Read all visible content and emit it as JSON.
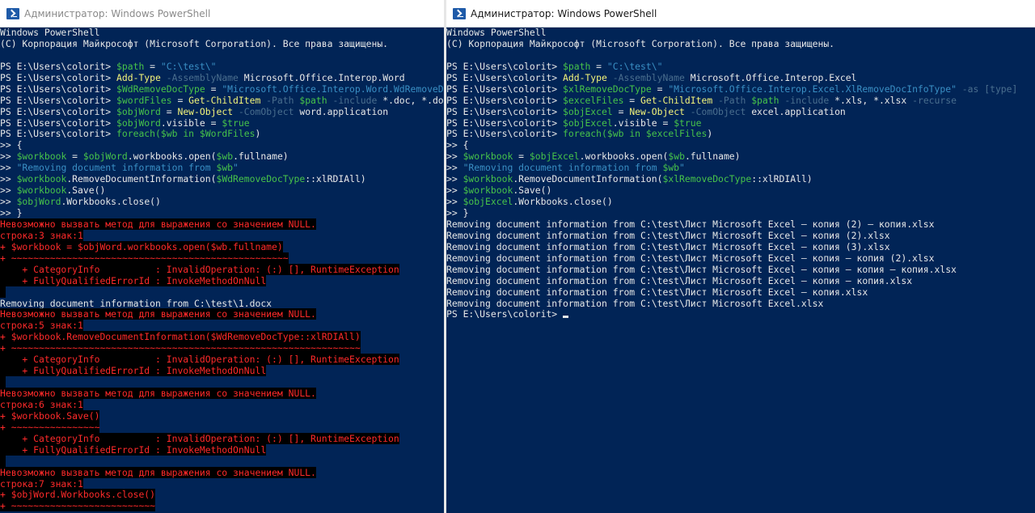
{
  "left": {
    "title": "Администратор: Windows PowerShell",
    "lines": [
      {
        "cls": "w",
        "segs": [
          {
            "t": "Windows PowerShell",
            "c": "w"
          }
        ]
      },
      {
        "cls": "w",
        "segs": [
          {
            "t": "(С) Корпорация Майкрософт (Microsoft Corporation). Все права защищены.",
            "c": "w"
          }
        ]
      },
      {
        "cls": "w",
        "segs": []
      },
      {
        "cls": "w",
        "segs": [
          {
            "t": "PS E:\\Users\\colorit> ",
            "c": "w"
          },
          {
            "t": "$path",
            "c": "g"
          },
          {
            "t": " = ",
            "c": "w"
          },
          {
            "t": "\"C:\\test\\\"",
            "c": "cy"
          }
        ]
      },
      {
        "cls": "w",
        "segs": [
          {
            "t": "PS E:\\Users\\colorit> ",
            "c": "w"
          },
          {
            "t": "Add-Type",
            "c": "y"
          },
          {
            "t": " -AssemblyName",
            "c": "gy"
          },
          {
            "t": " Microsoft.Office.Interop.Word",
            "c": "w"
          }
        ]
      },
      {
        "cls": "w",
        "segs": [
          {
            "t": "PS E:\\Users\\colorit> ",
            "c": "w"
          },
          {
            "t": "$WdRemoveDocType",
            "c": "g"
          },
          {
            "t": " = ",
            "c": "w"
          },
          {
            "t": "\"Microsoft.Office.Interop.Word.WdRemoveD",
            "c": "cy"
          }
        ]
      },
      {
        "cls": "w",
        "segs": [
          {
            "t": "PS E:\\Users\\colorit> ",
            "c": "w"
          },
          {
            "t": "$wordFiles",
            "c": "g"
          },
          {
            "t": " = ",
            "c": "w"
          },
          {
            "t": "Get-ChildItem",
            "c": "y"
          },
          {
            "t": " -Path ",
            "c": "gy"
          },
          {
            "t": "$path",
            "c": "g"
          },
          {
            "t": " -include",
            "c": "gy"
          },
          {
            "t": " *.doc, *.do",
            "c": "w"
          }
        ]
      },
      {
        "cls": "w",
        "segs": [
          {
            "t": "PS E:\\Users\\colorit> ",
            "c": "w"
          },
          {
            "t": "$objWord",
            "c": "g"
          },
          {
            "t": " = ",
            "c": "w"
          },
          {
            "t": "New-Object",
            "c": "y"
          },
          {
            "t": " -ComObject",
            "c": "gy"
          },
          {
            "t": " word.application",
            "c": "w"
          }
        ]
      },
      {
        "cls": "w",
        "segs": [
          {
            "t": "PS E:\\Users\\colorit> ",
            "c": "w"
          },
          {
            "t": "$objWord",
            "c": "g"
          },
          {
            "t": ".visible = ",
            "c": "w"
          },
          {
            "t": "$true",
            "c": "g"
          }
        ]
      },
      {
        "cls": "w",
        "segs": [
          {
            "t": "PS E:\\Users\\colorit> ",
            "c": "w"
          },
          {
            "t": "foreach(",
            "c": "g"
          },
          {
            "t": "$wb in $WordFiles",
            "c": "g"
          },
          {
            "t": ")",
            "c": "w"
          }
        ]
      },
      {
        "cls": "w",
        "segs": [
          {
            "t": ">> {",
            "c": "w"
          }
        ]
      },
      {
        "cls": "w",
        "segs": [
          {
            "t": ">> ",
            "c": "w"
          },
          {
            "t": "$workbook",
            "c": "g"
          },
          {
            "t": " = ",
            "c": "w"
          },
          {
            "t": "$objWord",
            "c": "g"
          },
          {
            "t": ".workbooks.open(",
            "c": "w"
          },
          {
            "t": "$wb",
            "c": "g"
          },
          {
            "t": ".fullname)",
            "c": "w"
          }
        ]
      },
      {
        "cls": "w",
        "segs": [
          {
            "t": ">> ",
            "c": "w"
          },
          {
            "t": "\"Removing document information from ",
            "c": "cy"
          },
          {
            "t": "$wb",
            "c": "g"
          },
          {
            "t": "\"",
            "c": "cy"
          }
        ]
      },
      {
        "cls": "w",
        "segs": [
          {
            "t": ">> ",
            "c": "w"
          },
          {
            "t": "$workbook",
            "c": "g"
          },
          {
            "t": ".RemoveDocumentInformation(",
            "c": "w"
          },
          {
            "t": "$WdRemoveDocType",
            "c": "g"
          },
          {
            "t": "::xlRDIAll)",
            "c": "w"
          }
        ]
      },
      {
        "cls": "w",
        "segs": [
          {
            "t": ">> ",
            "c": "w"
          },
          {
            "t": "$workbook",
            "c": "g"
          },
          {
            "t": ".Save()",
            "c": "w"
          }
        ]
      },
      {
        "cls": "w",
        "segs": [
          {
            "t": ">> ",
            "c": "w"
          },
          {
            "t": "$objWord",
            "c": "g"
          },
          {
            "t": ".Workbooks.close()",
            "c": "w"
          }
        ]
      },
      {
        "cls": "w",
        "segs": [
          {
            "t": ">> }",
            "c": "w"
          }
        ]
      },
      {
        "cls": "err",
        "segs": [
          {
            "t": "Невозможно вызвать метод для выражения со значением NULL.",
            "c": "errbg"
          }
        ]
      },
      {
        "cls": "err",
        "segs": [
          {
            "t": "строка:3 знак:1",
            "c": "errbg"
          }
        ]
      },
      {
        "cls": "err",
        "segs": [
          {
            "t": "+ $workbook = $objWord.workbooks.open($wb.fullname)",
            "c": "errbg"
          }
        ]
      },
      {
        "cls": "err",
        "segs": [
          {
            "t": "+ ~~~~~~~~~~~~~~~~~~~~~~~~~~~~~~~~~~~~~~~~~~~~~~~~~~",
            "c": "errbg"
          }
        ]
      },
      {
        "cls": "err",
        "segs": [
          {
            "t": "    + CategoryInfo          : InvalidOperation: (:) [], RuntimeException",
            "c": "errbg"
          }
        ]
      },
      {
        "cls": "err",
        "segs": [
          {
            "t": "    + FullyQualifiedErrorId : InvokeMethodOnNull",
            "c": "errbg"
          }
        ]
      },
      {
        "cls": "err",
        "segs": [
          {
            "t": " ",
            "c": "errbg"
          }
        ]
      },
      {
        "cls": "w",
        "segs": [
          {
            "t": "Removing document information from C:\\test\\1.docx",
            "c": "w"
          }
        ]
      },
      {
        "cls": "err",
        "segs": [
          {
            "t": "Невозможно вызвать метод для выражения со значением NULL.",
            "c": "errbg"
          }
        ]
      },
      {
        "cls": "err",
        "segs": [
          {
            "t": "строка:5 знак:1",
            "c": "errbg"
          }
        ]
      },
      {
        "cls": "err",
        "segs": [
          {
            "t": "+ $workbook.RemoveDocumentInformation($WdRemoveDocType::xlRDIAll)",
            "c": "errbg"
          }
        ]
      },
      {
        "cls": "err",
        "segs": [
          {
            "t": "+ ~~~~~~~~~~~~~~~~~~~~~~~~~~~~~~~~~~~~~~~~~~~~~~~~~~~~~~~~~~~~~~~",
            "c": "errbg"
          }
        ]
      },
      {
        "cls": "err",
        "segs": [
          {
            "t": "    + CategoryInfo          : InvalidOperation: (:) [], RuntimeException",
            "c": "errbg"
          }
        ]
      },
      {
        "cls": "err",
        "segs": [
          {
            "t": "    + FullyQualifiedErrorId : InvokeMethodOnNull",
            "c": "errbg"
          }
        ]
      },
      {
        "cls": "err",
        "segs": [
          {
            "t": " ",
            "c": "errbg"
          }
        ]
      },
      {
        "cls": "err",
        "segs": [
          {
            "t": "Невозможно вызвать метод для выражения со значением NULL.",
            "c": "errbg"
          }
        ]
      },
      {
        "cls": "err",
        "segs": [
          {
            "t": "строка:6 знак:1",
            "c": "errbg"
          }
        ]
      },
      {
        "cls": "err",
        "segs": [
          {
            "t": "+ $workbook.Save()",
            "c": "errbg"
          }
        ]
      },
      {
        "cls": "err",
        "segs": [
          {
            "t": "+ ~~~~~~~~~~~~~~~~",
            "c": "errbg"
          }
        ]
      },
      {
        "cls": "err",
        "segs": [
          {
            "t": "    + CategoryInfo          : InvalidOperation: (:) [], RuntimeException",
            "c": "errbg"
          }
        ]
      },
      {
        "cls": "err",
        "segs": [
          {
            "t": "    + FullyQualifiedErrorId : InvokeMethodOnNull",
            "c": "errbg"
          }
        ]
      },
      {
        "cls": "err",
        "segs": [
          {
            "t": " ",
            "c": "errbg"
          }
        ]
      },
      {
        "cls": "err",
        "segs": [
          {
            "t": "Невозможно вызвать метод для выражения со значением NULL.",
            "c": "errbg"
          }
        ]
      },
      {
        "cls": "err",
        "segs": [
          {
            "t": "строка:7 знак:1",
            "c": "errbg"
          }
        ]
      },
      {
        "cls": "err",
        "segs": [
          {
            "t": "+ $objWord.Workbooks.close()",
            "c": "errbg"
          }
        ]
      },
      {
        "cls": "err",
        "segs": [
          {
            "t": "+ ~~~~~~~~~~~~~~~~~~~~~~~~~~",
            "c": "errbg"
          }
        ]
      }
    ]
  },
  "right": {
    "title": "Администратор: Windows PowerShell",
    "lines": [
      {
        "cls": "w",
        "segs": [
          {
            "t": "Windows PowerShell",
            "c": "w"
          }
        ]
      },
      {
        "cls": "w",
        "segs": [
          {
            "t": "(С) Корпорация Майкрософт (Microsoft Corporation). Все права защищены.",
            "c": "w"
          }
        ]
      },
      {
        "cls": "w",
        "segs": []
      },
      {
        "cls": "w",
        "segs": [
          {
            "t": "PS E:\\Users\\colorit> ",
            "c": "w"
          },
          {
            "t": "$path",
            "c": "g"
          },
          {
            "t": " = ",
            "c": "w"
          },
          {
            "t": "\"C:\\test\\\"",
            "c": "cy"
          }
        ]
      },
      {
        "cls": "w",
        "segs": [
          {
            "t": "PS E:\\Users\\colorit> ",
            "c": "w"
          },
          {
            "t": "Add-Type",
            "c": "y"
          },
          {
            "t": " -AssemblyName",
            "c": "gy"
          },
          {
            "t": " Microsoft.Office.Interop.Excel",
            "c": "w"
          }
        ]
      },
      {
        "cls": "w",
        "segs": [
          {
            "t": "PS E:\\Users\\colorit> ",
            "c": "w"
          },
          {
            "t": "$xlRemoveDocType",
            "c": "g"
          },
          {
            "t": " = ",
            "c": "w"
          },
          {
            "t": "\"Microsoft.Office.Interop.Excel.XlRemoveDocInfoType\"",
            "c": "cy"
          },
          {
            "t": " -as [type]",
            "c": "gy"
          }
        ]
      },
      {
        "cls": "w",
        "segs": [
          {
            "t": "PS E:\\Users\\colorit> ",
            "c": "w"
          },
          {
            "t": "$excelFiles",
            "c": "g"
          },
          {
            "t": " = ",
            "c": "w"
          },
          {
            "t": "Get-ChildItem",
            "c": "y"
          },
          {
            "t": " -Path ",
            "c": "gy"
          },
          {
            "t": "$path",
            "c": "g"
          },
          {
            "t": " -include",
            "c": "gy"
          },
          {
            "t": " *.xls, *.xlsx ",
            "c": "w"
          },
          {
            "t": "-recurse",
            "c": "gy"
          }
        ]
      },
      {
        "cls": "w",
        "segs": [
          {
            "t": "PS E:\\Users\\colorit> ",
            "c": "w"
          },
          {
            "t": "$objExcel",
            "c": "g"
          },
          {
            "t": " = ",
            "c": "w"
          },
          {
            "t": "New-Object",
            "c": "y"
          },
          {
            "t": " -ComObject",
            "c": "gy"
          },
          {
            "t": " excel.application",
            "c": "w"
          }
        ]
      },
      {
        "cls": "w",
        "segs": [
          {
            "t": "PS E:\\Users\\colorit> ",
            "c": "w"
          },
          {
            "t": "$objExcel",
            "c": "g"
          },
          {
            "t": ".visible = ",
            "c": "w"
          },
          {
            "t": "$true",
            "c": "g"
          }
        ]
      },
      {
        "cls": "w",
        "segs": [
          {
            "t": "PS E:\\Users\\colorit> ",
            "c": "w"
          },
          {
            "t": "foreach(",
            "c": "g"
          },
          {
            "t": "$wb in $excelFiles",
            "c": "g"
          },
          {
            "t": ")",
            "c": "w"
          }
        ]
      },
      {
        "cls": "w",
        "segs": [
          {
            "t": ">> {",
            "c": "w"
          }
        ]
      },
      {
        "cls": "w",
        "segs": [
          {
            "t": ">> ",
            "c": "w"
          },
          {
            "t": "$workbook",
            "c": "g"
          },
          {
            "t": " = ",
            "c": "w"
          },
          {
            "t": "$objExcel",
            "c": "g"
          },
          {
            "t": ".workbooks.open(",
            "c": "w"
          },
          {
            "t": "$wb",
            "c": "g"
          },
          {
            "t": ".fullname)",
            "c": "w"
          }
        ]
      },
      {
        "cls": "w",
        "segs": [
          {
            "t": ">> ",
            "c": "w"
          },
          {
            "t": "\"Removing document information from ",
            "c": "cy"
          },
          {
            "t": "$wb",
            "c": "g"
          },
          {
            "t": "\"",
            "c": "cy"
          }
        ]
      },
      {
        "cls": "w",
        "segs": [
          {
            "t": ">> ",
            "c": "w"
          },
          {
            "t": "$workbook",
            "c": "g"
          },
          {
            "t": ".RemoveDocumentInformation(",
            "c": "w"
          },
          {
            "t": "$xlRemoveDocType",
            "c": "g"
          },
          {
            "t": "::xlRDIAll)",
            "c": "w"
          }
        ]
      },
      {
        "cls": "w",
        "segs": [
          {
            "t": ">> ",
            "c": "w"
          },
          {
            "t": "$workbook",
            "c": "g"
          },
          {
            "t": ".Save()",
            "c": "w"
          }
        ]
      },
      {
        "cls": "w",
        "segs": [
          {
            "t": ">> ",
            "c": "w"
          },
          {
            "t": "$objExcel",
            "c": "g"
          },
          {
            "t": ".Workbooks.close()",
            "c": "w"
          }
        ]
      },
      {
        "cls": "w",
        "segs": [
          {
            "t": ">> }",
            "c": "w"
          }
        ]
      },
      {
        "cls": "w",
        "segs": [
          {
            "t": "Removing document information from C:\\test\\Лист Microsoft Excel — копия (2) — копия.xlsx",
            "c": "w"
          }
        ]
      },
      {
        "cls": "w",
        "segs": [
          {
            "t": "Removing document information from C:\\test\\Лист Microsoft Excel — копия (2).xlsx",
            "c": "w"
          }
        ]
      },
      {
        "cls": "w",
        "segs": [
          {
            "t": "Removing document information from C:\\test\\Лист Microsoft Excel — копия (3).xlsx",
            "c": "w"
          }
        ]
      },
      {
        "cls": "w",
        "segs": [
          {
            "t": "Removing document information from C:\\test\\Лист Microsoft Excel — копия — копия (2).xlsx",
            "c": "w"
          }
        ]
      },
      {
        "cls": "w",
        "segs": [
          {
            "t": "Removing document information from C:\\test\\Лист Microsoft Excel — копия — копия — копия.xlsx",
            "c": "w"
          }
        ]
      },
      {
        "cls": "w",
        "segs": [
          {
            "t": "Removing document information from C:\\test\\Лист Microsoft Excel — копия — копия.xlsx",
            "c": "w"
          }
        ]
      },
      {
        "cls": "w",
        "segs": [
          {
            "t": "Removing document information from C:\\test\\Лист Microsoft Excel — копия.xlsx",
            "c": "w"
          }
        ]
      },
      {
        "cls": "w",
        "segs": [
          {
            "t": "Removing document information from C:\\test\\Лист Microsoft Excel.xlsx",
            "c": "w"
          }
        ]
      },
      {
        "cls": "w",
        "segs": [
          {
            "t": "PS E:\\Users\\colorit> ",
            "c": "w"
          }
        ],
        "cursor": true
      }
    ]
  }
}
